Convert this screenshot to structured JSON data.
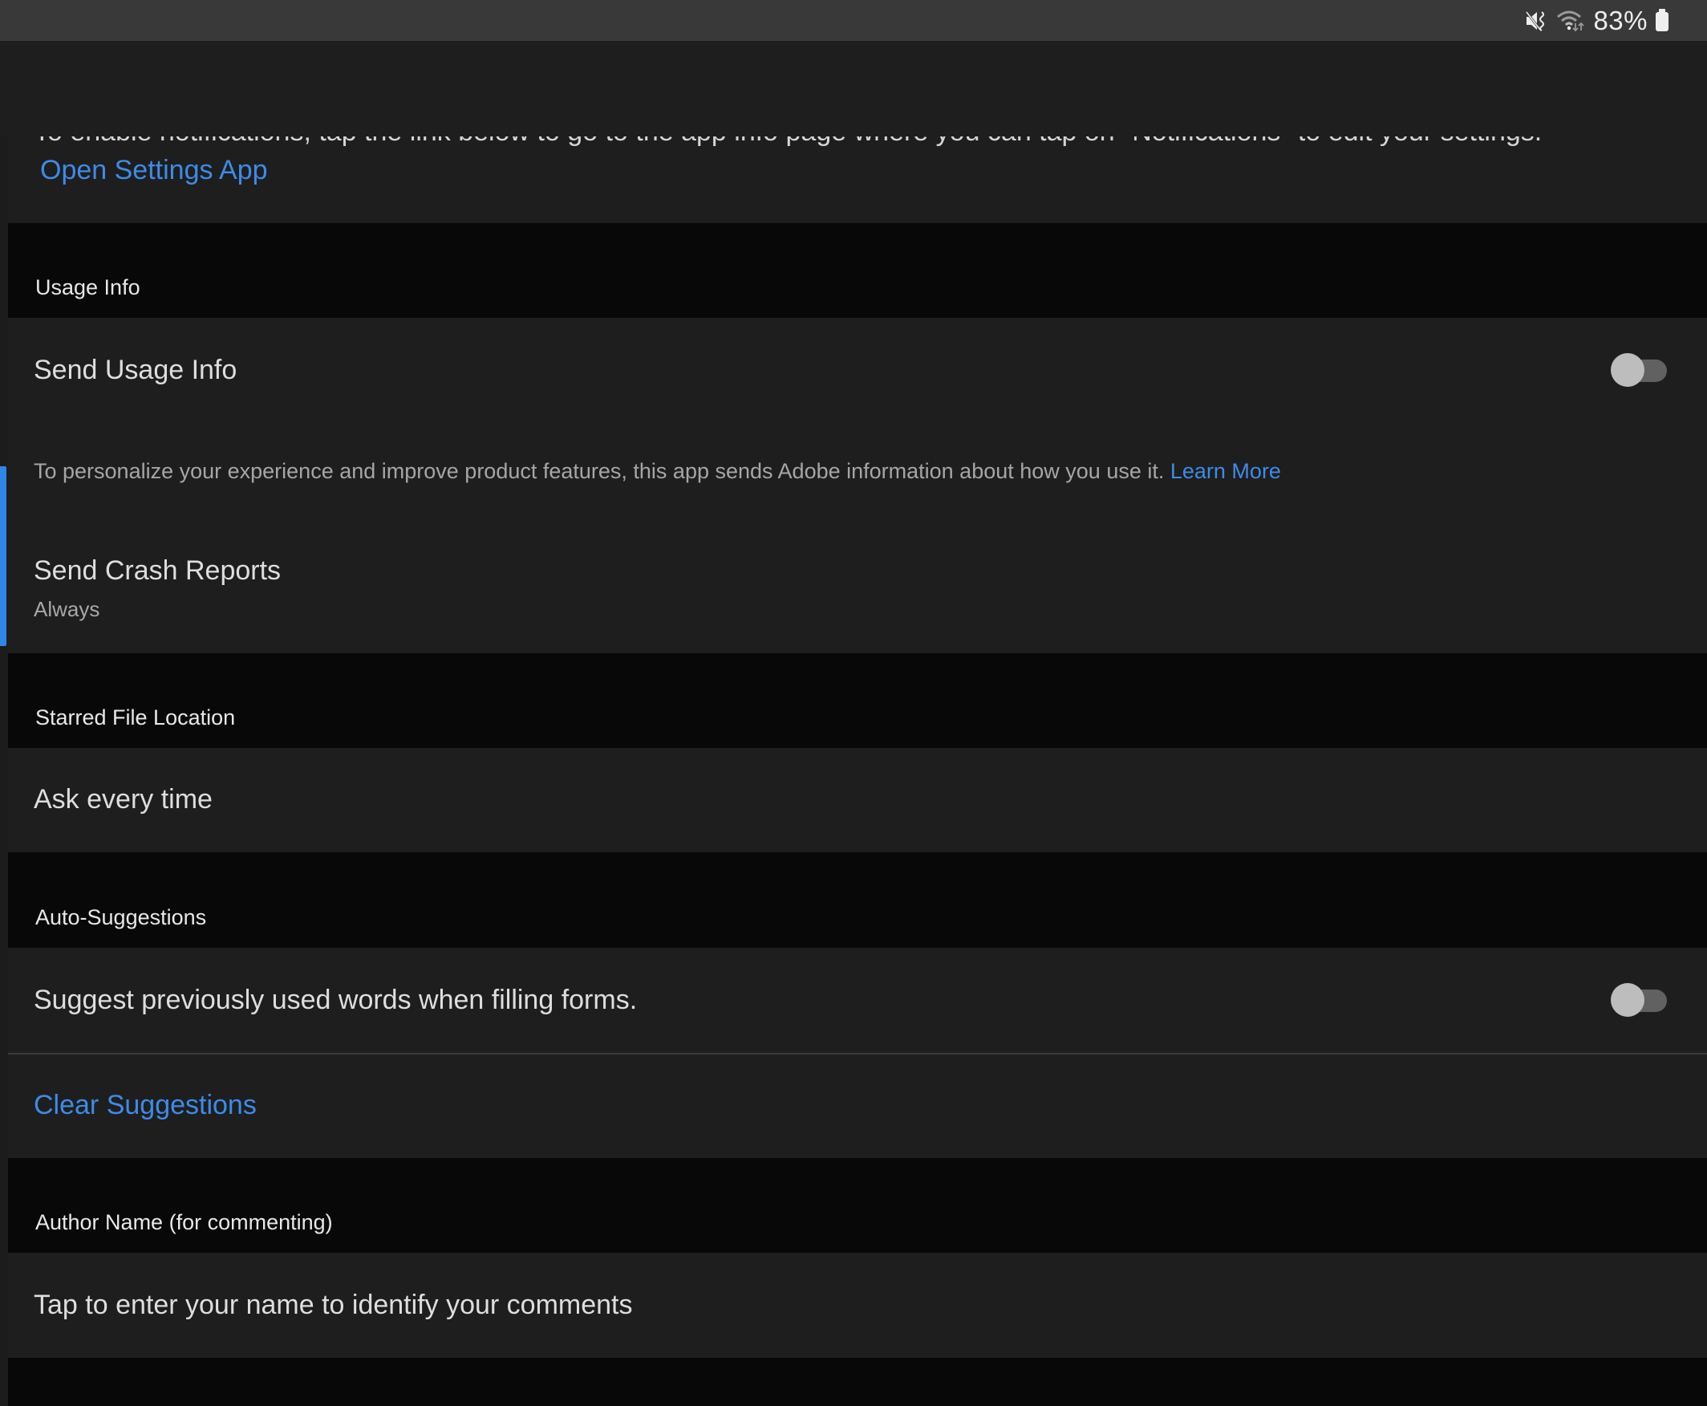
{
  "status_bar": {
    "icons": [
      "mute-vibrate-icon",
      "wifi-icon",
      "battery-icon"
    ],
    "battery_percent": "83%"
  },
  "notifications": {
    "clipped_text": "To enable notifications, tap the link below to go to the app info page where you can tap on \"Notifications\" to edit your settings.",
    "open_settings_link": "Open Settings App"
  },
  "usage_info": {
    "section_label": "Usage Info",
    "send_usage": {
      "label": "Send Usage Info",
      "enabled": false
    },
    "description": "To personalize your experience and improve product features, this app sends Adobe information about how you use it.",
    "learn_more_link": "Learn More",
    "crash_reports": {
      "label": "Send Crash Reports",
      "value": "Always"
    }
  },
  "starred_file_location": {
    "section_label": "Starred File Location",
    "value": "Ask every time"
  },
  "auto_suggestions": {
    "section_label": "Auto-Suggestions",
    "suggest": {
      "label": "Suggest previously used words when filling forms.",
      "enabled": false
    },
    "clear_button": "Clear Suggestions"
  },
  "author_name": {
    "section_label": "Author Name (for commenting)",
    "placeholder": "Tap to enter your name to identify your comments"
  },
  "colors": {
    "accent": "#3d8be8",
    "row_bg": "#1e1e1e",
    "section_bg": "#080808",
    "status_bar_bg": "#393939",
    "toggle_track_off": "#616161",
    "toggle_thumb_off": "#bdbdbd"
  }
}
